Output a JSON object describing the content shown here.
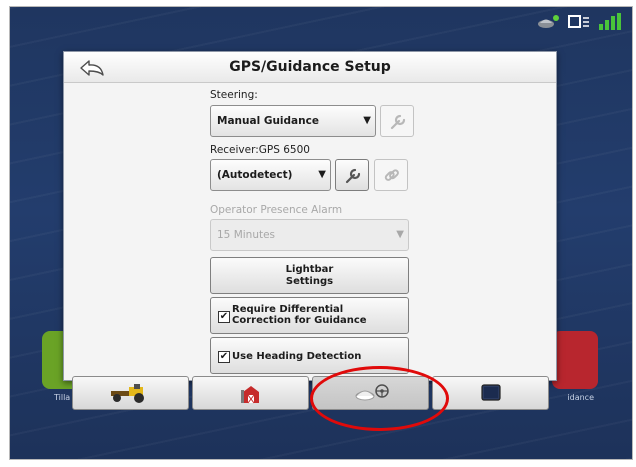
{
  "dialog": {
    "title": "GPS/Guidance Setup",
    "steering": {
      "label": "Steering:",
      "value": "Manual Guidance"
    },
    "receiver": {
      "label": "Receiver:GPS 6500",
      "value": "(Autodetect)"
    },
    "operator_alarm": {
      "label": "Operator Presence Alarm",
      "value": "15 Minutes"
    },
    "lightbar_button": {
      "line1": "Lightbar",
      "line2": "Settings"
    },
    "differential_checkbox": {
      "line1": "Require Differential",
      "line2": "Correction for Guidance",
      "checked": true
    },
    "heading_checkbox": {
      "label": "Use Heading Detection",
      "checked": true
    }
  },
  "background": {
    "left_caption": "Tilla",
    "right_caption": "idance"
  },
  "bottom_bar": {
    "tabs": [
      "vehicle-icon",
      "farm-icon",
      "gps-guidance-icon",
      "display-icon"
    ],
    "selected": 2
  },
  "status_icons": [
    "gps-status-icon",
    "display-status-icon",
    "signal-status-icon"
  ],
  "colors": {
    "highlight": "#e00a0a",
    "background": "#1f3660",
    "left_tile": "#6aa326",
    "right_tile": "#b8262e"
  }
}
